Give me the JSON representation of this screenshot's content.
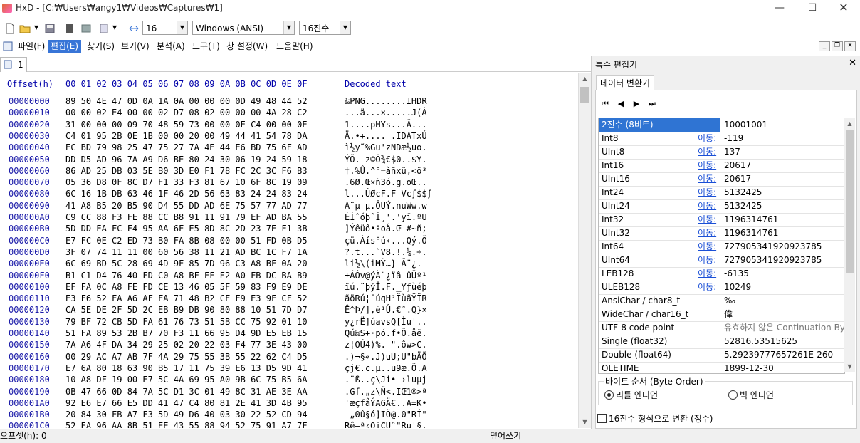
{
  "window": {
    "title": "HxD - [C:₩Users₩angy1₩Videos₩Captures₩1]"
  },
  "toolbar": {
    "bytes_per_row": "16",
    "charset": "Windows (ANSI)",
    "offset_base": "16진수"
  },
  "menu": [
    "파일(F)",
    "편집(E)",
    "찾기(S)",
    "보기(V)",
    "분석(A)",
    "도구(T)",
    "창 설정(W)",
    "도움말(H)"
  ],
  "tab": {
    "label": "1"
  },
  "hex_header": {
    "offset": "Offset(h)",
    "columns": "00 01 02 03 04 05 06 07 08 09 0A 0B 0C 0D 0E 0F",
    "decoded": "Decoded text"
  },
  "rows": [
    {
      "off": "00000000",
      "hex": "89 50 4E 47 0D 0A 1A 0A 00 00 00 0D 49 48 44 52",
      "txt": "‰PNG........IHDR"
    },
    {
      "off": "00000010",
      "hex": "00 00 02 E4 00 00 02 D7 08 02 00 00 00 4A 28 C2",
      "txt": "...ä...×.....J(Â"
    },
    {
      "off": "00000020",
      "hex": "31 00 00 00 09 70 48 59 73 00 00 0E C4 00 00 0E",
      "txt": "1....pHYs...Ä..."
    },
    {
      "off": "00000030",
      "hex": "C4 01 95 2B 0E 1B 00 00 20 00 49 44 41 54 78 DA",
      "txt": "Ä.•+.... .IDATxÚ"
    },
    {
      "off": "00000040",
      "hex": "EC BD 79 98 25 47 75 27 7A 4E 44 E6 BD 75 6F AD",
      "txt": "ì½y˜%Gu'zNDæ½uo."
    },
    {
      "off": "00000050",
      "hex": "DD D5 AD 96 7A A9 D6 BE 80 24 30 06 19 24 59 18",
      "txt": "ÝÕ.–z©Ö¾€$0..$Y."
    },
    {
      "off": "00000060",
      "hex": "86 AD 25 DB 03 5E B0 3D E0 F1 78 FC 2C 3C F6 B3",
      "txt": "†.%Û.^°=àñxü,<ö³"
    },
    {
      "off": "00000070",
      "hex": "05 36 D8 0F 8C D7 F1 33 F3 81 67 10 6F 8C 19 09",
      "txt": ".6Ø.Œ×ñ3ó.g.oŒ.."
    },
    {
      "off": "00000080",
      "hex": "6C 16 1B DB 63 46 1F 46 2D 56 63 83 24 24 83 24",
      "txt": "l...ÛØcF.F-Vcƒ$$ƒ"
    },
    {
      "off": "00000090",
      "hex": "41 A8 B5 20 B5 90 D4 55 DD AD 6E 75 57 77 AD 77",
      "txt": "A¨µ µ.ÔUÝ.nuWw.w"
    },
    {
      "off": "000000A0",
      "hex": "C9 CC 88 F3 FE 88 CC B8 91 11 91 79 EF AD BA 55",
      "txt": "ÉÌˆóþˆÌ¸'.'yï.ºU"
    },
    {
      "off": "000000B0",
      "hex": "5D DD EA FC F4 95 AA 6F E5 8D 8C 2D 23 7E F1 3B",
      "txt": "]Ýêüô•ªoå.Œ-#~ñ;"
    },
    {
      "off": "000000C0",
      "hex": "E7 FC 0E C2 ED 73 B0 FA 8B 08 00 00 51 FD 0B D5",
      "txt": "çü.Âís°ú‹...Qý.Õ"
    },
    {
      "off": "000000D0",
      "hex": "3F 07 74 11 11 00 60 56 38 11 21 AD BC 1C F7 1A",
      "txt": "?.t...`V8.!.¼.÷."
    },
    {
      "off": "000000E0",
      "hex": "6C 69 BD 5C 28 69 4D 9F 85 7D 96 C3 A8 BF 0A 20",
      "txt": "li½\\(iMŸ…}–Ã¨¿. "
    },
    {
      "off": "000000F0",
      "hex": "B1 C1 D4 76 40 FD C0 A8 BF EF E2 A0 FB DC BA B9",
      "txt": "±ÁÔv@ýÀ¨¿ïâ ûÜº¹"
    },
    {
      "off": "00000100",
      "hex": "EF FA 0C A8 FE FD CE 13 46 05 5F 59 83 F9 E9 DE",
      "txt": "ïú.¨þýÎ.F._Yƒùéþ"
    },
    {
      "off": "00000110",
      "hex": "E3 F6 52 FA A6 AF FA 71 48 B2 CF F9 E3 9F CF 52",
      "txt": "ãöRú¦¯úqH²ÏùãŸÏR"
    },
    {
      "off": "00000120",
      "hex": "CA 5E DE 2F 5D 2C EB B9 DB 90 80 88 10 51 7D D7",
      "txt": "Ê^Þ/],ë¹Û.€ˆ.Q}×"
    },
    {
      "off": "00000130",
      "hex": "79 BF 72 CB 5D FA 61 76 73 51 5B CC 75 92 01 10",
      "txt": "y¿rË]úavsQ[Ìu'.."
    },
    {
      "off": "00000140",
      "hex": "51 FA 89 53 2B B7 70 F3 11 66 95 D4 9D E5 EB 15",
      "txt": "Qú‰S+·pó.f•Ô.åë."
    },
    {
      "off": "00000150",
      "hex": "7A A6 4F DA 34 29 25 02 20 22 03 F4 77 3E 43 00",
      "txt": "z¦OÚ4)%. \".ôw>C."
    },
    {
      "off": "00000160",
      "hex": "00 29 AC A7 AB 7F 4A 29 75 55 3B 55 22 62 C4 D5",
      "txt": ".)¬§«.J)uU;U\"bÄÕ"
    },
    {
      "off": "00000170",
      "hex": "E7 6A 80 18 63 90 B5 17 11 75 39 E6 13 D5 9D 41",
      "txt": "çj€.c.µ..u9æ.Õ.A"
    },
    {
      "off": "00000180",
      "hex": "10 A8 DF 19 00 E7 5C 4A 69 95 A0 9B 6C 75 B5 6A",
      "txt": ".¨ß..ç\\Ji• ›luµj"
    },
    {
      "off": "00000190",
      "hex": "0B 47 66 0D 84 7A 5C D1 3C 01 49 8C 31 AE 3E AA",
      "txt": ".Gf.„z\\Ñ<.IŒ1®>ª"
    },
    {
      "off": "000001A0",
      "hex": "92 E6 E7 66 E5 DD 41 47 C4 80 81 2E 41 3D 4B 95",
      "txt": "'æçfåÝAGÄ€..A=K•"
    },
    {
      "off": "000001B0",
      "hex": "20 84 30 FB A7 F3 5D 49 D6 40 03 30 22 52 CD 94",
      "txt": " „0û§ó]IÖ@.0\"RÍ\""
    },
    {
      "off": "000001C0",
      "hex": "52 EA 96 AA 8B 51 EE 43 55 88 94 52 75 91 A7 7F",
      "txt": "Rê–ª‹QîCUˆ\"Ru'§."
    }
  ],
  "status": {
    "offset_label": "오프셋(h): 0",
    "mode": "덮어쓰기"
  },
  "panel": {
    "title": "특수 편집기",
    "tab": "데이터 변환기",
    "rows": [
      {
        "label": "2진수 (8비트)",
        "link": "",
        "value": "10001001"
      },
      {
        "label": "Int8",
        "link": "이동:",
        "value": "-119"
      },
      {
        "label": "UInt8",
        "link": "이동:",
        "value": "137"
      },
      {
        "label": "Int16",
        "link": "이동:",
        "value": "20617"
      },
      {
        "label": "UInt16",
        "link": "이동:",
        "value": "20617"
      },
      {
        "label": "Int24",
        "link": "이동:",
        "value": "5132425"
      },
      {
        "label": "UInt24",
        "link": "이동:",
        "value": "5132425"
      },
      {
        "label": "Int32",
        "link": "이동:",
        "value": "1196314761"
      },
      {
        "label": "UInt32",
        "link": "이동:",
        "value": "1196314761"
      },
      {
        "label": "Int64",
        "link": "이동:",
        "value": "727905341920923785"
      },
      {
        "label": "UInt64",
        "link": "이동:",
        "value": "727905341920923785"
      },
      {
        "label": "LEB128",
        "link": "이동:",
        "value": "-6135"
      },
      {
        "label": "ULEB128",
        "link": "이동:",
        "value": "10249"
      },
      {
        "label": "AnsiChar / char8_t",
        "link": "",
        "value": "‰"
      },
      {
        "label": "WideChar / char16_t",
        "link": "",
        "value": "偉"
      },
      {
        "label": "UTF-8 code point",
        "link": "",
        "value": "유효하지 않은 Continuation By"
      },
      {
        "label": "Single (float32)",
        "link": "",
        "value": "52816.53515625"
      },
      {
        "label": "Double (float64)",
        "link": "",
        "value": "5.29239777657261E-260"
      },
      {
        "label": "OLETIME",
        "link": "",
        "value": "1899-12-30"
      }
    ],
    "byte_order": {
      "label": "바이트 순서 (Byte Order)",
      "little": "리틀 엔디언",
      "big": "빅 엔디언"
    },
    "hex_checkbox": "16진수 형식으로 변환 (정수)"
  },
  "colors": {
    "accent": "#3875d7",
    "offset": "#1a1aa8",
    "header": "#0000aa",
    "link": "#1a4fd6"
  }
}
